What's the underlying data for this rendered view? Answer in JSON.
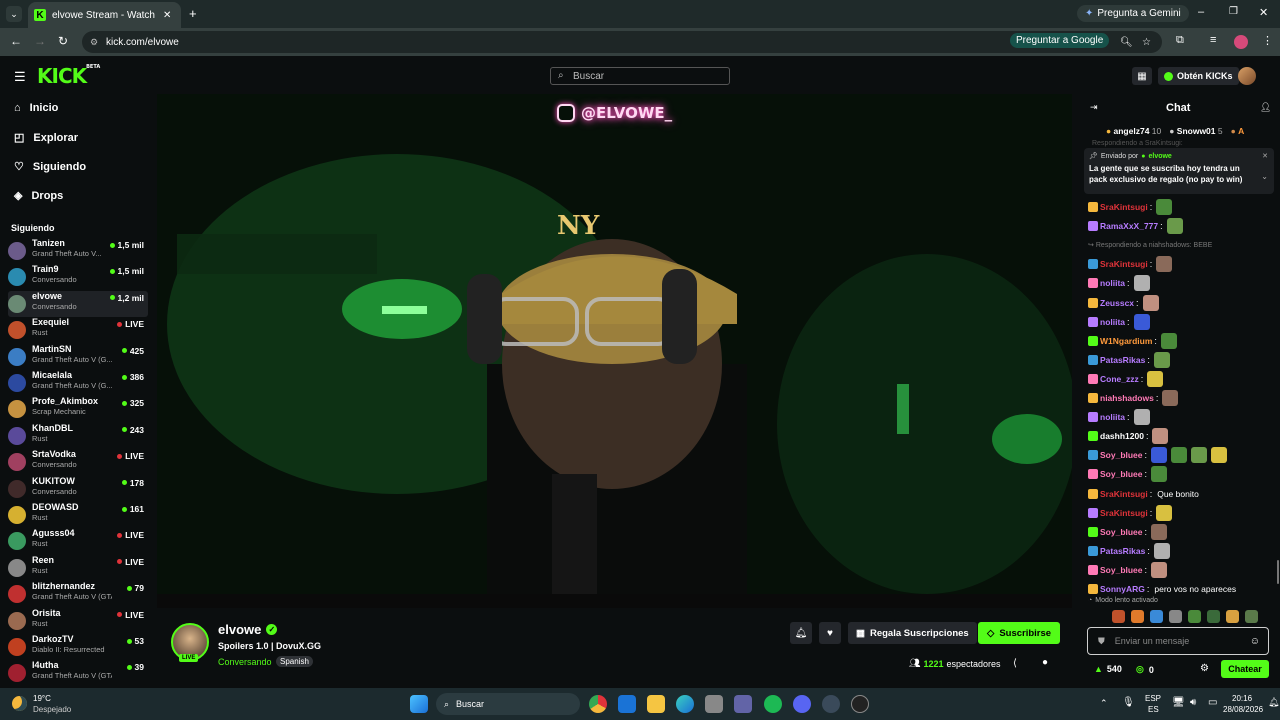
{
  "browser": {
    "tab_title": "elvowe Stream - Watch Live",
    "url": "kick.com/elvowe",
    "gemini_button": "Pregunta a Gemini",
    "google_button": "Preguntar a Google"
  },
  "header": {
    "logo": "KICK",
    "logo_beta": "BETA",
    "search_placeholder": "Buscar",
    "get_kicks": "Obtén KICKs"
  },
  "nav": [
    {
      "label": "Inicio"
    },
    {
      "label": "Explorar"
    },
    {
      "label": "Siguiendo"
    },
    {
      "label": "Drops"
    }
  ],
  "following_title": "Siguiendo",
  "following": [
    {
      "name": "Tanizen",
      "game": "Grand Theft Auto V...",
      "viewers": "1,5 mil",
      "color": "#6b5b8a"
    },
    {
      "name": "Train9",
      "game": "Conversando",
      "viewers": "1,5 mil",
      "color": "#2a8bb0"
    },
    {
      "name": "elvowe",
      "game": "Conversando",
      "viewers": "1,2 mil",
      "color": "#6a8a74"
    },
    {
      "name": "Exequiel",
      "game": "Rust",
      "viewers": "LIVE",
      "color": "#c0502b"
    },
    {
      "name": "MartinSN",
      "game": "Grand Theft Auto V (G...",
      "viewers": "425",
      "color": "#3b7dc4"
    },
    {
      "name": "Micaelala",
      "game": "Grand Theft Auto V (G...",
      "viewers": "386",
      "color": "#2c4aa0"
    },
    {
      "name": "Profe_Akimbox",
      "game": "Scrap Mechanic",
      "viewers": "325",
      "color": "#c69240"
    },
    {
      "name": "KhanDBL",
      "game": "Rust",
      "viewers": "243",
      "color": "#5a4a9a"
    },
    {
      "name": "SrtaVodka",
      "game": "Conversando",
      "viewers": "LIVE",
      "color": "#a04060"
    },
    {
      "name": "KUKITOW",
      "game": "Conversando",
      "viewers": "178",
      "color": "#402a2a"
    },
    {
      "name": "DEOWASD",
      "game": "Rust",
      "viewers": "161",
      "color": "#d6b030"
    },
    {
      "name": "Agusss04",
      "game": "Rust",
      "viewers": "LIVE",
      "color": "#3a9a60"
    },
    {
      "name": "Reen",
      "game": "Rust",
      "viewers": "LIVE",
      "color": "#888888"
    },
    {
      "name": "blitzhernandez",
      "game": "Grand Theft Auto V (GTA)",
      "viewers": "79",
      "color": "#c03030"
    },
    {
      "name": "Orisita",
      "game": "Rust",
      "viewers": "LIVE",
      "color": "#9a6a50"
    },
    {
      "name": "DarkozTV",
      "game": "Diablo II: Resurrected",
      "viewers": "53",
      "color": "#c04020"
    },
    {
      "name": "l4utha",
      "game": "Grand Theft Auto V (GTA)",
      "viewers": "39",
      "color": "#a02030"
    }
  ],
  "video": {
    "overlay_text": "@ELVOWE_"
  },
  "stream": {
    "streamer": "elvowe",
    "title": "Spoilers 1.0 | DovuX.GG",
    "category": "Conversando",
    "language": "Spanish",
    "live_badge": "LIVE",
    "gift_button": "Regala Suscripciones",
    "subscribe_button": "Suscribirse",
    "viewers": "1221",
    "viewers_label": "espectadores"
  },
  "chat": {
    "title": "Chat",
    "top_gifters": [
      {
        "name": "angelz74",
        "count": "10"
      },
      {
        "name": "Snoww01",
        "count": "5"
      },
      {
        "name": "A",
        "count": ""
      }
    ],
    "replying_faded": "Respondiendo a SraKintsugi:",
    "pinned_sent_by": "Enviado por",
    "pinned_author": "elvowe",
    "pinned_message": "La gente que se suscriba hoy tendra un pack exclusivo de regalo (no pay to win)",
    "messages": [
      {
        "user": "SraKintsugi",
        "color": "#e0333a",
        "text": ""
      },
      {
        "user": "RamaXxX_777",
        "color": "#b77cff",
        "text": ""
      },
      {
        "reply": "Respondiendo a niahshadows: BEBE"
      },
      {
        "user": "SraKintsugi",
        "color": "#e0333a",
        "text": ""
      },
      {
        "user": "noliita",
        "color": "#b77cff",
        "text": ""
      },
      {
        "user": "Zeusscx",
        "color": "#b77cff",
        "text": ""
      },
      {
        "user": "noliita",
        "color": "#b77cff",
        "text": ""
      },
      {
        "user": "W1Ngardium",
        "color": "#ff9a3c",
        "text": ""
      },
      {
        "user": "PatasRikas",
        "color": "#b77cff",
        "text": ""
      },
      {
        "user": "Cone_zzz",
        "color": "#b77cff",
        "text": ""
      },
      {
        "user": "niahshadows",
        "color": "#ff7ab6",
        "text": ""
      },
      {
        "user": "noliita",
        "color": "#b77cff",
        "text": ""
      },
      {
        "user": "dashh1200",
        "color": "#ffffff",
        "text": ""
      },
      {
        "user": "Soy_bluee",
        "color": "#ff7ab6",
        "text": ""
      },
      {
        "user": "Soy_bluee",
        "color": "#ff7ab6",
        "text": ""
      },
      {
        "user": "SraKintsugi",
        "color": "#e0333a",
        "text": "Que bonito"
      },
      {
        "user": "SraKintsugi",
        "color": "#e0333a",
        "text": ""
      },
      {
        "user": "Soy_bluee",
        "color": "#ff7ab6",
        "text": ""
      },
      {
        "user": "PatasRikas",
        "color": "#b77cff",
        "text": ""
      },
      {
        "user": "Soy_bluee",
        "color": "#ff7ab6",
        "text": ""
      },
      {
        "user": "SonnyARG",
        "color": "#b77cff",
        "text": "pero vos no apareces"
      }
    ],
    "slow_mode": "Modo lento activado",
    "input_placeholder": "Enviar un mensaje",
    "kicks_count": "540",
    "points_count": "0",
    "send_button": "Chatear"
  },
  "taskbar": {
    "weather_temp": "19°C",
    "weather_desc": "Despejado",
    "search": "Buscar",
    "lang": "ESP",
    "lang_sub": "ES",
    "time": "20:16",
    "date": "28/08/2026"
  }
}
